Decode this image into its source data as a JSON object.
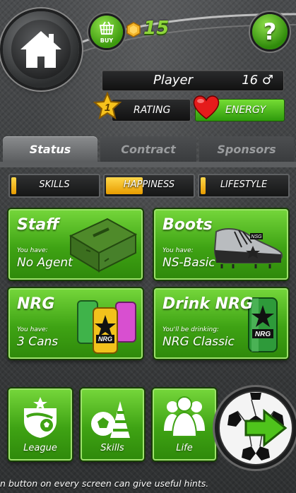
{
  "top": {
    "buy_label": "BUY",
    "coins": "15"
  },
  "player": {
    "name": "Player",
    "age_gender": "16 ♂",
    "rating_level": "1",
    "rating_label": "RATING",
    "energy_label": "ENERGY"
  },
  "tabs": [
    {
      "label": "Status",
      "active": true
    },
    {
      "label": "Contract",
      "active": false
    },
    {
      "label": "Sponsors",
      "active": false
    }
  ],
  "stats": [
    {
      "label": "SKILLS",
      "level": 0.06
    },
    {
      "label": "HAPPINESS",
      "level": 0.43
    },
    {
      "label": "LIFESTYLE",
      "level": 0.06
    }
  ],
  "cards": {
    "staff": {
      "title": "Staff",
      "sub": "You have:",
      "value": "No Agent"
    },
    "boots": {
      "title": "Boots",
      "sub": "You have:",
      "value": "NS-Basic",
      "brand": "NSG"
    },
    "nrg": {
      "title": "NRG",
      "sub": "You have:",
      "value": "3 Cans",
      "can_text": "NRG"
    },
    "drink": {
      "title": "Drink NRG",
      "sub": "You'll be drinking:",
      "value": "NRG Classic",
      "can_text": "NRG"
    }
  },
  "nav": {
    "league": "League",
    "skills": "Skills",
    "life": "Life"
  },
  "hint": "n button on every screen can give useful hints.",
  "colors": {
    "green": "#3fa314",
    "yellow_fill": "#f2b400",
    "energy_green": "#4cbf1e"
  }
}
